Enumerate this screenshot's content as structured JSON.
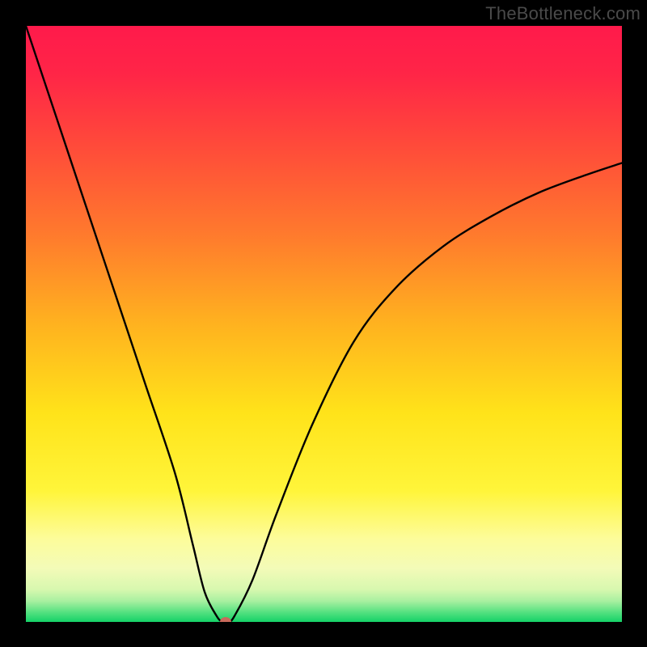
{
  "watermark": "TheBottleneck.com",
  "chart_data": {
    "type": "line",
    "title": "",
    "xlabel": "",
    "ylabel": "",
    "xlim": [
      0,
      100
    ],
    "ylim": [
      0,
      100
    ],
    "grid": false,
    "legend": false,
    "gradient_stops": [
      {
        "pos": 0.0,
        "color": "#ff1a4b"
      },
      {
        "pos": 0.08,
        "color": "#ff2547"
      },
      {
        "pos": 0.2,
        "color": "#ff4a3a"
      },
      {
        "pos": 0.35,
        "color": "#ff7a2d"
      },
      {
        "pos": 0.5,
        "color": "#ffb21f"
      },
      {
        "pos": 0.65,
        "color": "#ffe31a"
      },
      {
        "pos": 0.78,
        "color": "#fff53a"
      },
      {
        "pos": 0.86,
        "color": "#fdfc9a"
      },
      {
        "pos": 0.91,
        "color": "#f3fbb8"
      },
      {
        "pos": 0.945,
        "color": "#d8f8af"
      },
      {
        "pos": 0.965,
        "color": "#a8f0a0"
      },
      {
        "pos": 0.985,
        "color": "#4fe07e"
      },
      {
        "pos": 1.0,
        "color": "#15d268"
      }
    ],
    "series": [
      {
        "name": "bottleneck-curve",
        "x": [
          0,
          5,
          10,
          15,
          20,
          25,
          28,
          30,
          32,
          33,
          34,
          35,
          38,
          42,
          48,
          55,
          62,
          70,
          78,
          86,
          94,
          100
        ],
        "values": [
          100,
          85,
          70,
          55,
          40,
          25,
          13,
          5,
          1,
          0,
          0,
          1,
          7,
          18,
          33,
          47,
          56,
          63,
          68,
          72,
          75,
          77
        ]
      }
    ],
    "marker": {
      "x": 33.5,
      "y": 0,
      "color": "#c96a5b"
    }
  }
}
